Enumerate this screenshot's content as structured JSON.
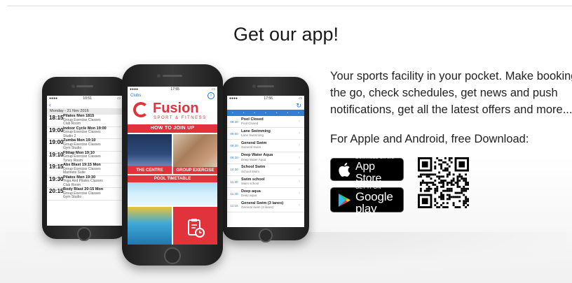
{
  "heading": "Get our app!",
  "blurb_lines": [
    "Your sports facility in your pocket. Make booking",
    "the go, check schedules, get news and push",
    "notifications, get all the latest offers and more..."
  ],
  "download_label": "For Apple and Android, free Download:",
  "app_store": {
    "small": "Download on the",
    "big": "App Store"
  },
  "google_play": {
    "small": "GET IT ON",
    "big": "Google play"
  },
  "phone_left": {
    "time": "10:51",
    "date": "Monday - 21 Nov 2016",
    "classes": [
      {
        "time": "18:15",
        "title": "Pilates Mon 1815",
        "type": "Group Exercise Classes",
        "room": "Club Room"
      },
      {
        "time": "19:00",
        "title": "Indoor Cycle Mon 19:00",
        "type": "Group Exercise Classes",
        "room": "Studio 2"
      },
      {
        "time": "19:00",
        "title": "Zumba Mon 19:10",
        "type": "Group Exercise Classes",
        "room": "Gym Studio"
      },
      {
        "time": "19:10",
        "title": "Flittap Mon 19:10",
        "type": "Group Exercise Classes",
        "room": "Tyney Room"
      },
      {
        "time": "19:15",
        "title": "Abs Blast 19:15 Mon",
        "type": "Group Exercise Classes",
        "room": "Marinets Suite"
      },
      {
        "time": "19:30",
        "title": "Pilates Mon 19:30",
        "type": "Yoga And Pilates Classes",
        "room": "Club Room"
      },
      {
        "time": "20:15",
        "title": "Body Blast 20:15 Mon",
        "type": "Group Exercise Classes",
        "room": "Gym Studio"
      }
    ]
  },
  "phone_middle": {
    "time": "17:55",
    "nav_left": "Clubs",
    "brand": "Fusion",
    "brand_sub": "SPORT & FITNESS",
    "how_to_join": "HOW TO JOIN UP",
    "tiles": {
      "centre": "THE CENTRE",
      "group": "GROUP EXERCISE",
      "pool": "POOL TIMETABLE"
    }
  },
  "phone_right": {
    "time": "17:56",
    "sessions": [
      {
        "time": "08:30",
        "title": "Pool Closed",
        "sub": "Pool Closed"
      },
      {
        "time": "09:00",
        "title": "Lane Swimming",
        "sub": "Lane Swimming"
      },
      {
        "time": "09:30",
        "title": "General Swim",
        "sub": "General Swim"
      },
      {
        "time": "09:30",
        "title": "Deep Water Aqua",
        "sub": "Deep Water Aqua"
      },
      {
        "time": "10:30",
        "title": "School Swim",
        "sub": "School Swim"
      },
      {
        "time": "11:30",
        "title": "Swim school",
        "sub": "Swim school"
      },
      {
        "time": "11:30",
        "title": "Deep aqua",
        "sub": "Deep aqua"
      },
      {
        "time": "11:15",
        "title": "General Swim (3 lanes)",
        "sub": "General swim (3 lanes)"
      }
    ]
  },
  "colors": {
    "fusion_red": "#e1333b",
    "ios_blue": "#1a73e8"
  }
}
